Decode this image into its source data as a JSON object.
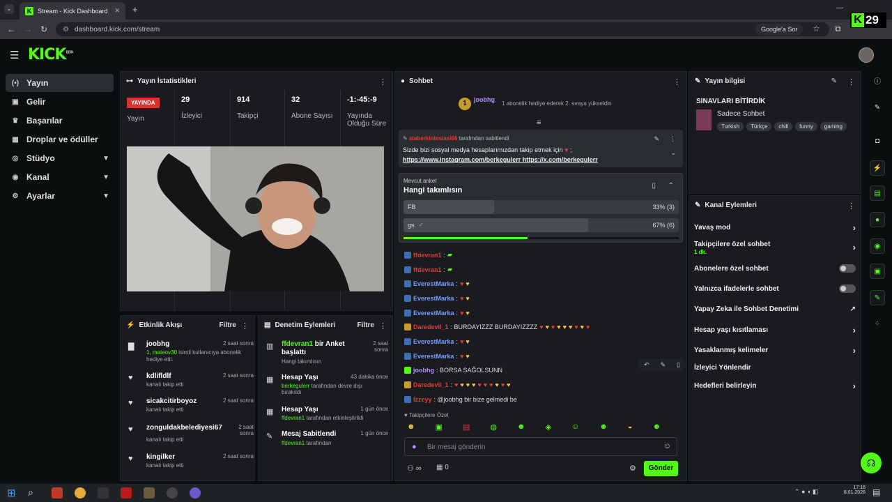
{
  "browser": {
    "tab_title": "Stream - Kick Dashboard",
    "url": "dashboard.kick.com/stream",
    "google_button": "Google'a Sor",
    "overlay_number": "29"
  },
  "nav": {
    "logo": "KICK",
    "logo_badge": "BETA",
    "items": [
      {
        "label": "Yayın",
        "icon": "broadcast-icon"
      },
      {
        "label": "Gelir",
        "icon": "money-icon"
      },
      {
        "label": "Başarılar",
        "icon": "trophy-icon"
      },
      {
        "label": "Droplar ve ödüller",
        "icon": "gift-icon"
      },
      {
        "label": "Stüdyo",
        "icon": "studio-icon"
      },
      {
        "label": "Kanal",
        "icon": "channel-icon"
      },
      {
        "label": "Ayarlar",
        "icon": "gear-icon"
      }
    ]
  },
  "stats": {
    "title": "Yayın İstatistikleri",
    "live_badge": "YAYINDA",
    "live_label": "Yayın",
    "viewers": "29",
    "viewers_label": "İzleyici",
    "followers": "914",
    "followers_label": "Takipçi",
    "subs": "32",
    "subs_label": "Abone Sayısı",
    "duration": "-1:-45:-9",
    "duration_label": "Yayında Olduğu Süre"
  },
  "activity": {
    "title": "Etkinlik Akışı",
    "filter": "Filtre",
    "items": [
      {
        "name": "joobhg",
        "sub_user": "1, mateov30",
        "sub": " isimli kullanıcıya abonelik hediye etti.",
        "time": "2 saat sonra"
      },
      {
        "name": "kdlifldlf",
        "sub": "kanalı takip etti",
        "time": "2 saat sonra"
      },
      {
        "name": "sicakcitirboyoz",
        "sub": "kanalı takip etti",
        "time": "2 saat sonra"
      },
      {
        "name": "zonguldakbelediyesi67",
        "sub": "kanalı takip etti",
        "time": "2 saat sonra"
      },
      {
        "name": "kingilker",
        "sub": "kanalı takip etti",
        "time": "2 saat sonra"
      }
    ]
  },
  "moderation": {
    "title": "Denetim Eylemleri",
    "filter": "Filtre",
    "items": [
      {
        "user": "ffdevran1",
        "title": " bir Anket başlattı",
        "sub": "Hangi takımlısın",
        "time": "2 saat sonra"
      },
      {
        "title": "Hesap Yaşı",
        "user": "berkegulerr",
        "sub": " tarafından devre dışı bırakıldı",
        "time": "43 dakika önce"
      },
      {
        "title": "Hesap Yaşı",
        "user": "ffdevran1",
        "sub": " tarafından etkinleştirildi",
        "time": "1 gün önce"
      },
      {
        "title": "Mesaj Sabitlendi",
        "user": "ffdevran1",
        "sub": " tarafından",
        "time": "1 gün önce"
      }
    ]
  },
  "chat": {
    "title": "Sohbet",
    "top_user": "joobhg",
    "top_rank": "1",
    "top_msg": "1 abonelik hediye ederek 2. sıraya yükseldin",
    "pinned_by": "ataberkinteslasi66",
    "pinned_suffix": " tarafından sabitlendi",
    "pinned_msg": "Sizde bizi sosyal medya hesaplarımızdan takip etmek için",
    "pinned_link1": "https://www.instagram.com/berkegulerr",
    "pinned_link2": "https://x.com/berkegulerr",
    "poll_label": "Mevcut anket",
    "poll_question": "Hangi takımlısın",
    "poll_options": [
      {
        "name": "FB",
        "result": "33% (3)",
        "pct": 0.33
      },
      {
        "name": "gs",
        "result": "67% (6)",
        "pct": 0.67
      }
    ],
    "messages": [
      {
        "user": "ffdevran1",
        "color": "#e53935",
        "text": ":"
      },
      {
        "user": "ffdevran1",
        "color": "#e53935",
        "text": ":"
      },
      {
        "user": "EverestMarka",
        "color": "#7a9cff",
        "text": ":"
      },
      {
        "user": "EverestMarka",
        "color": "#7a9cff",
        "text": ":"
      },
      {
        "user": "EverestMarka",
        "color": "#7a9cff",
        "text": ":"
      },
      {
        "user": "Daredevil_1",
        "color": "#e53935",
        "text": ": BURDAYIZZZ BURDAYIZZZZ"
      },
      {
        "user": "EverestMarka",
        "color": "#7a9cff",
        "text": ":"
      },
      {
        "user": "EverestMarka",
        "color": "#7a9cff",
        "text": ":"
      },
      {
        "user": "joobhg",
        "color": "#b98cff",
        "text": ": BORSA SAĞOLSUNN"
      },
      {
        "user": "Daredevil_1",
        "color": "#e53935",
        "text": ":"
      },
      {
        "user": "Izzeyy",
        "color": "#e53935",
        "text": ": @joobhg bir bize gelmedi be"
      }
    ],
    "followers_only_label": "Takipçilere Özel",
    "input_placeholder": "Bir mesaj gönderin",
    "points": "0",
    "send": "Gönder"
  },
  "info": {
    "title": "Yayın bilgisi",
    "stream_title": "SINAVLARI BİTİRDİK",
    "category": "Sadece Sohbet",
    "tags": [
      "Turkish",
      "Türkçe",
      "chill",
      "funny",
      "gaming"
    ]
  },
  "channel_actions": {
    "title": "Kanal Eylemleri",
    "items": [
      {
        "label": "Yavaş mod",
        "kind": "arrow"
      },
      {
        "label": "Takipçilere özel sohbet",
        "sub": "1 dk.",
        "kind": "arrow"
      },
      {
        "label": "Abonelere özel sohbet",
        "kind": "toggle"
      },
      {
        "label": "Yalnızca ifadelerle sohbet",
        "kind": "toggle"
      },
      {
        "label": "Yapay Zeka ile Sohbet Denetimi",
        "kind": "ext"
      },
      {
        "label": "Hesap yaşı kısıtlaması",
        "kind": "arrow"
      },
      {
        "label": "Yasaklanmış kelimeler",
        "kind": "arrow"
      },
      {
        "label": "İzleyici Yönlendir",
        "kind": "none"
      },
      {
        "label": "Hedefleri belirleyin",
        "kind": "arrow"
      }
    ]
  },
  "taskbar": {
    "time": "17:16",
    "date": "8.01.2026"
  },
  "colors": {
    "accent": "#53fc18",
    "live": "#d8312f",
    "panel": "#191b1f"
  }
}
